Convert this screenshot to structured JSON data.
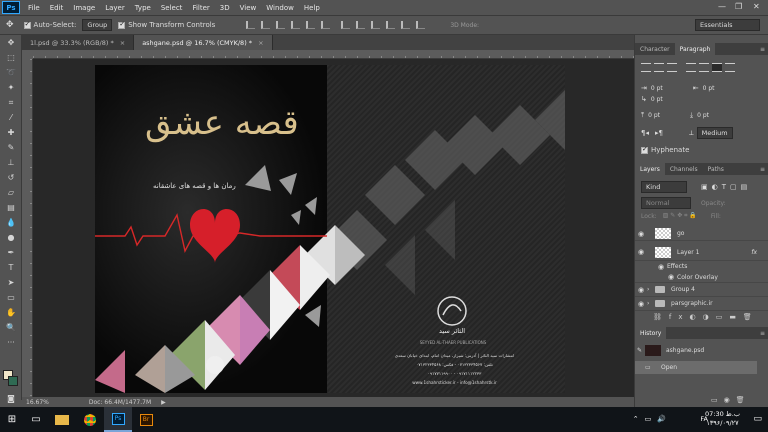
{
  "menu": {
    "logo": "Ps",
    "items": [
      "File",
      "Edit",
      "Image",
      "Layer",
      "Type",
      "Select",
      "Filter",
      "3D",
      "View",
      "Window",
      "Help"
    ]
  },
  "options": {
    "auto_select_label": "Auto-Select:",
    "auto_select_value": "Group",
    "transform_label": "Show Transform Controls",
    "mode_3d": "3D Mode:",
    "workspace": "Essentials"
  },
  "tabs": [
    {
      "label": "1l.psd @ 33.3% (RGB/8) *",
      "active": false
    },
    {
      "label": "ashgane.psd @ 16.7% (CMYK/8) *",
      "active": true
    }
  ],
  "document": {
    "title_ar": "قصه عشق",
    "subtitle_ar": "رمان ها و قصه های عاشقانه",
    "logo_text": "الثائر سید",
    "logo_sub": "SEYYED AL-THAER PUBLICATIONS",
    "info1": "انتشارات سید الثائر | آدرس: شیراز، میدان امام، ابتدای خیابان سعدی",
    "info2": "تلفن: ۰۷۱۳۲۳۳۴۵۶۷ - فکس: ۰۷۱۳۲۳۳۴۵۶۸",
    "info3": "۰۹۱۷۱۱۱۲۲۳۳ - ۰۹۱۷۷۱۱۹۹۰۰",
    "info4": "www.1shahrsticker.ir - info@1shahrstk.ir"
  },
  "status": {
    "zoom": "16.67%",
    "doc": "Doc: 66.4M/1477.7M"
  },
  "panels": {
    "top_tabs": [
      "Character",
      "Paragraph"
    ],
    "pt_values": [
      "0 pt",
      "0 pt",
      "0 pt",
      "0 pt",
      "0 pt"
    ],
    "justify": "Medium",
    "hyphenate": "Hyphenate",
    "layer_tabs": [
      "Layers",
      "Channels",
      "Paths"
    ],
    "kind": "Kind",
    "blend": "Normal",
    "opacity_label": "Opacity:",
    "lock_label": "Lock:",
    "fill_label": "Fill:",
    "layers": [
      {
        "name": "go",
        "type": "pixel"
      },
      {
        "name": "Layer 1",
        "type": "pixel",
        "fx": "fx"
      },
      {
        "name": "Effects",
        "type": "effect"
      },
      {
        "name": "Color Overlay",
        "type": "effect-item"
      },
      {
        "name": "Group 4",
        "type": "group"
      },
      {
        "name": "parsgraphic.ir",
        "type": "group"
      }
    ],
    "history_tab": "History",
    "history": [
      {
        "name": "ashgane.psd",
        "type": "snapshot"
      },
      {
        "name": "Open",
        "type": "state"
      }
    ]
  },
  "taskbar": {
    "time": "07:30 ب.ظ",
    "date": "۱۳۹۶/۰۹/۲۷",
    "lang": "FA"
  }
}
